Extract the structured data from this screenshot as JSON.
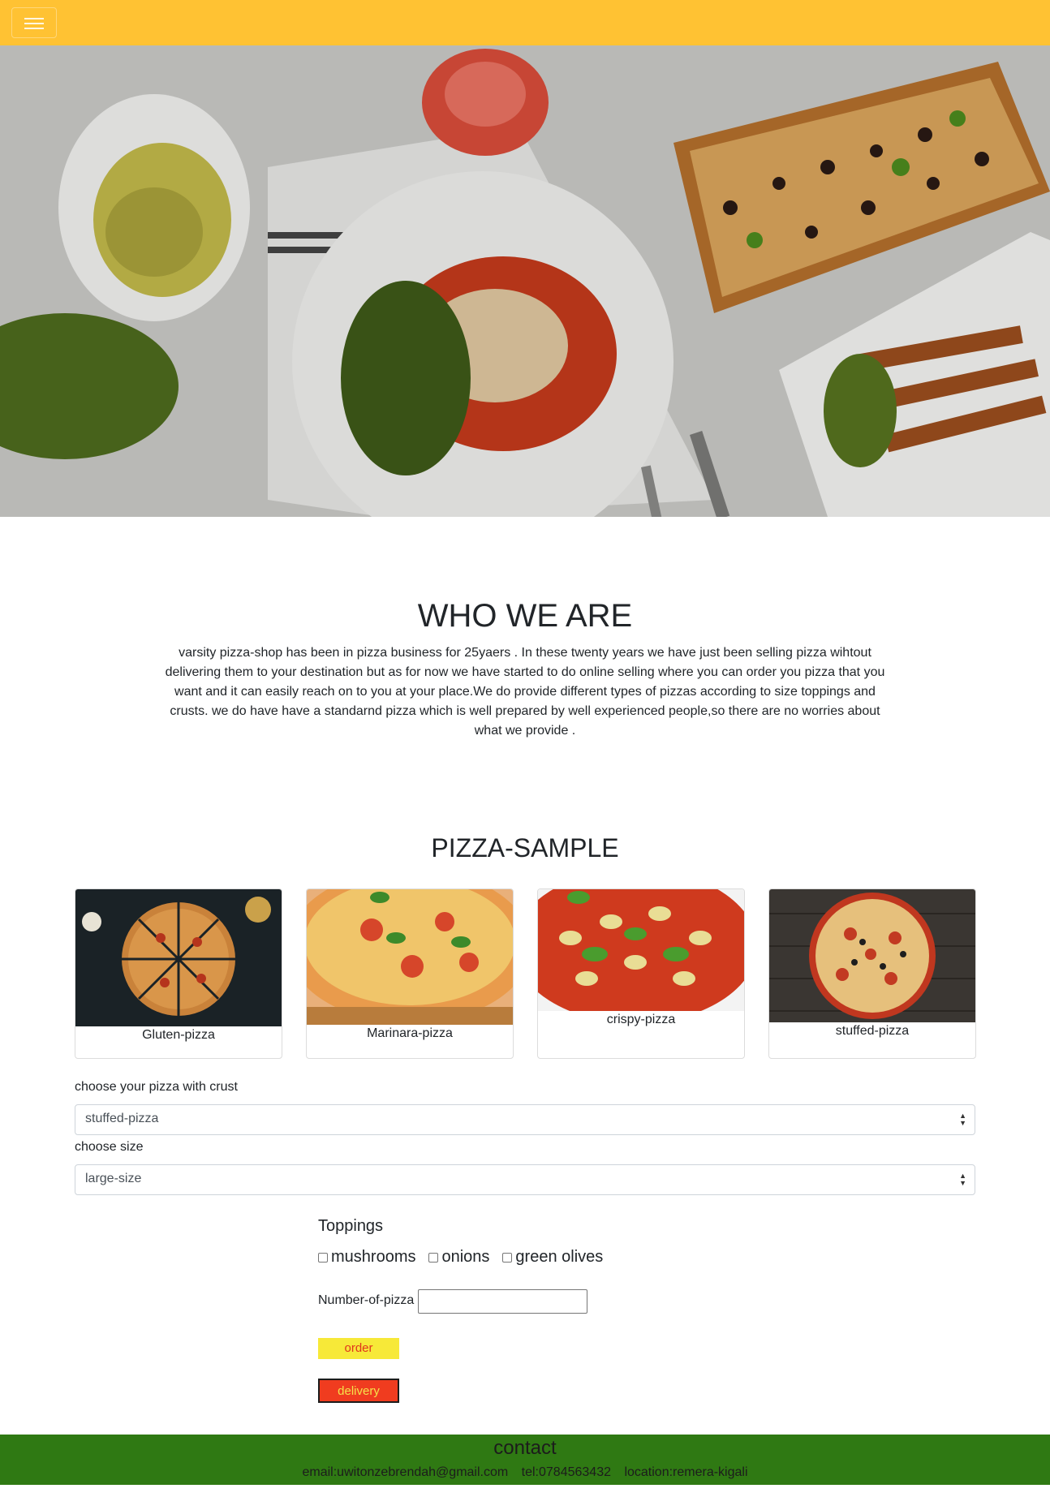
{
  "navbar": {
    "toggle_icon": "hamburger-icon",
    "color": "#ffc233"
  },
  "hero": {
    "image": "food-table-photo"
  },
  "about": {
    "title": "WHO WE ARE",
    "text": "varsity pizza-shop has been in pizza business for 25yaers . In these twenty years we have just been selling pizza wihtout delivering them to your destination but as for now we have started to do online selling where you can order you pizza that you want and it can easily reach on to you at your place.We do provide different types of pizzas according to size toppings and crusts. we do have have a standarnd pizza which is well prepared by well experienced people,so there are no worries about what we provide ."
  },
  "sample": {
    "title": "PIZZA-SAMPLE",
    "cards": [
      {
        "label": "Gluten-pizza"
      },
      {
        "label": "Marinara-pizza"
      },
      {
        "label": "crispy-pizza"
      },
      {
        "label": "stuffed-pizza"
      }
    ]
  },
  "form": {
    "crust_label": "choose your pizza with crust",
    "crust_value": "stuffed-pizza",
    "size_label": "choose size",
    "size_value": "large-size",
    "toppings_title": "Toppings",
    "toppings": [
      "mushrooms",
      "onions",
      "green olives"
    ],
    "number_label": "Number-of-pizza",
    "number_value": "",
    "order_label": "order",
    "delivery_label": "delivery"
  },
  "footer": {
    "title": "contact",
    "email": "email:uwitonzebrendah@gmail.com",
    "tel": "tel:0784563432",
    "location": "location:remera-kigali",
    "color": "#2f7913"
  }
}
